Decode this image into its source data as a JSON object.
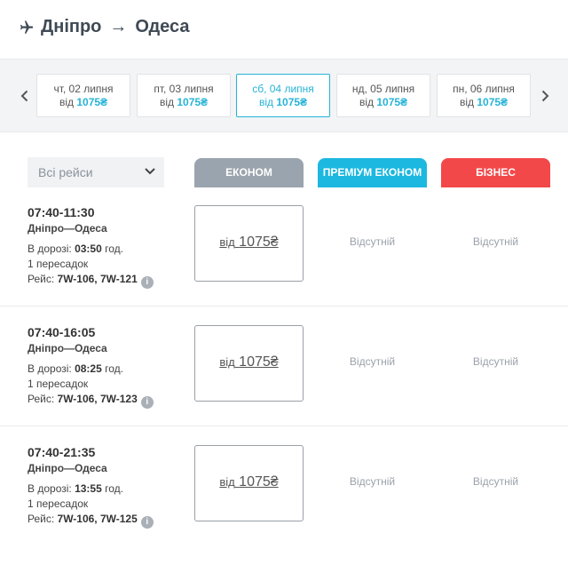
{
  "header": {
    "from": "Дніпро",
    "arrow": "→",
    "to": "Одеса",
    "plane_icon": "airplane-icon"
  },
  "dates": [
    {
      "line1": "чт, 02 липня",
      "from": "від",
      "price": "1075₴",
      "active": false
    },
    {
      "line1": "пт, 03 липня",
      "from": "від",
      "price": "1075₴",
      "active": false
    },
    {
      "line1": "сб, 04 липня",
      "from": "від",
      "price": "1075₴",
      "active": true
    },
    {
      "line1": "нд, 05 липня",
      "from": "від",
      "price": "1075₴",
      "active": false
    },
    {
      "line1": "пн, 06 липня",
      "from": "від",
      "price": "1075₴",
      "active": false
    }
  ],
  "filter": {
    "value": "Всі рейси"
  },
  "classes": {
    "economy": "ЕКОНОМ",
    "premium": "ПРЕМІУМ ЕКОНОМ",
    "business": "БІЗНЕС"
  },
  "colors": {
    "accent": "#26b3d6",
    "economy": "#9aa4ae",
    "premium": "#1cb8e0",
    "business": "#f2484a"
  },
  "flights": [
    {
      "time": "07:40-11:30",
      "route": "Дніпро—Одеса",
      "dur_label": "В дорозі:",
      "dur": "03:50",
      "dur_unit": "год.",
      "stops": "1 пересадок",
      "flt_label": "Рейс:",
      "flights": "7W-106, 7W-121",
      "fare_from": "від",
      "fare": "1075₴",
      "premium": "Відсутній",
      "business": "Відсутній"
    },
    {
      "time": "07:40-16:05",
      "route": "Дніпро—Одеса",
      "dur_label": "В дорозі:",
      "dur": "08:25",
      "dur_unit": "год.",
      "stops": "1 пересадок",
      "flt_label": "Рейс:",
      "flights": "7W-106, 7W-123",
      "fare_from": "від",
      "fare": "1075₴",
      "premium": "Відсутній",
      "business": "Відсутній"
    },
    {
      "time": "07:40-21:35",
      "route": "Дніпро—Одеса",
      "dur_label": "В дорозі:",
      "dur": "13:55",
      "dur_unit": "год.",
      "stops": "1 пересадок",
      "flt_label": "Рейс:",
      "flights": "7W-106, 7W-125",
      "fare_from": "від",
      "fare": "1075₴",
      "premium": "Відсутній",
      "business": "Відсутній"
    }
  ]
}
